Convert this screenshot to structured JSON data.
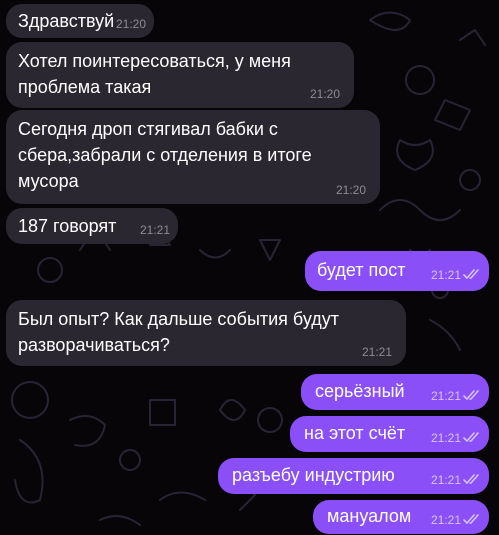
{
  "chat": {
    "messages": [
      {
        "dir": "in",
        "text": "Здравствуй",
        "time": "21:20"
      },
      {
        "dir": "in",
        "text": "Хотел поинтересоваться, у меня\nпроблема такая",
        "time": "21:20"
      },
      {
        "dir": "in",
        "text": "Сегодня дроп стягивал бабки с\nсбера,забрали с отделения в итоге\nмусора",
        "time": "21:20"
      },
      {
        "dir": "in",
        "text": "187 говорят",
        "time": "21:21"
      },
      {
        "dir": "out",
        "text": "будет пост",
        "time": "21:21",
        "status": "read"
      },
      {
        "dir": "in",
        "text": "Был опыт? Как дальше события будут\nразворачиваться?",
        "time": "21:21"
      },
      {
        "dir": "out",
        "text": "серьёзный",
        "time": "21:21",
        "status": "read"
      },
      {
        "dir": "out",
        "text": "на этот счёт",
        "time": "21:21",
        "status": "read"
      },
      {
        "dir": "out",
        "text": "разъебу индустрию",
        "time": "21:21",
        "status": "read"
      },
      {
        "dir": "out",
        "text": "мануалом",
        "time": "21:21",
        "status": "read"
      }
    ]
  },
  "colors": {
    "background": "#070508",
    "incoming_bubble": "#2b2730",
    "outgoing_bubble": "#8a4ff7",
    "doodle_stroke": "#2a2333"
  },
  "icons": {
    "read_status": "double-check-icon"
  }
}
